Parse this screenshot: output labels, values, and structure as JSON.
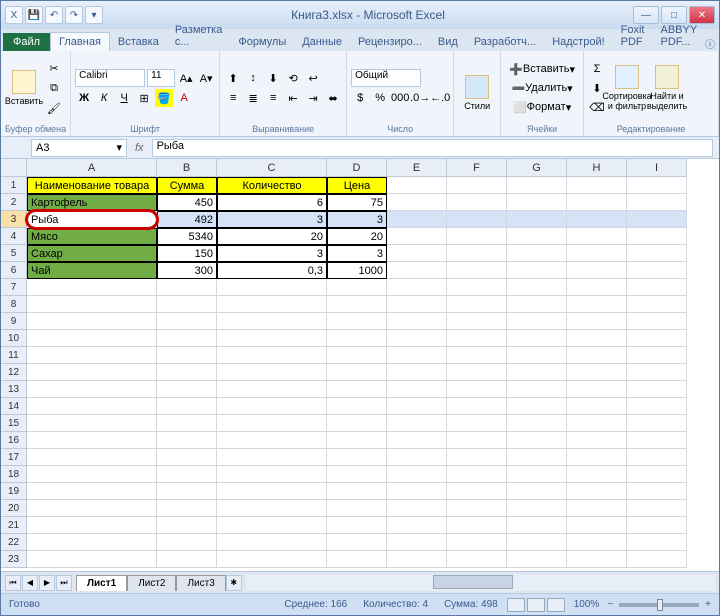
{
  "title": "Книга3.xlsx - Microsoft Excel",
  "qat": {
    "save": "💾",
    "undo": "↶",
    "redo": "↷"
  },
  "tabs": {
    "file": "Файл",
    "items": [
      "Главная",
      "Вставка",
      "Разметка с...",
      "Формулы",
      "Данные",
      "Рецензиро...",
      "Вид",
      "Разработч...",
      "Надстрой!",
      "Foxit PDF",
      "ABBYY PDF..."
    ],
    "active": "Главная"
  },
  "ribbon": {
    "clipboard": {
      "paste": "Вставить",
      "label": "Буфер обмена"
    },
    "font": {
      "name": "Calibri",
      "size": "11",
      "label": "Шрифт"
    },
    "alignment": {
      "label": "Выравнивание"
    },
    "number": {
      "format": "Общий",
      "label": "Число"
    },
    "styles": {
      "btn": "Стили",
      "label": ""
    },
    "cells": {
      "insert": "Вставить",
      "delete": "Удалить",
      "format": "Формат",
      "label": "Ячейки"
    },
    "editing": {
      "sort": "Сортировка и фильтр",
      "find": "Найти и выделить",
      "label": "Редактирование"
    }
  },
  "name_box": "A3",
  "formula": "Рыба",
  "columns": [
    "A",
    "B",
    "C",
    "D",
    "E",
    "F",
    "G",
    "H",
    "I"
  ],
  "headers": {
    "name": "Наименование товара",
    "sum": "Сумма",
    "qty": "Количество",
    "price": "Цена"
  },
  "data": [
    {
      "name": "Картофель",
      "sum": "450",
      "qty": "6",
      "price": "75"
    },
    {
      "name": "Рыба",
      "sum": "492",
      "qty": "3",
      "price": "3"
    },
    {
      "name": "Мясо",
      "sum": "5340",
      "qty": "20",
      "price": "20"
    },
    {
      "name": "Сахар",
      "sum": "150",
      "qty": "3",
      "price": "3"
    },
    {
      "name": "Чай",
      "sum": "300",
      "qty": "0,3",
      "price": "1000"
    }
  ],
  "selected_row": 1,
  "sheets": [
    "Лист1",
    "Лист2",
    "Лист3"
  ],
  "status": {
    "ready": "Готово",
    "avg_lbl": "Среднее:",
    "avg": "166",
    "cnt_lbl": "Количество:",
    "cnt": "4",
    "sum_lbl": "Сумма:",
    "sum": "498",
    "zoom": "100%"
  }
}
